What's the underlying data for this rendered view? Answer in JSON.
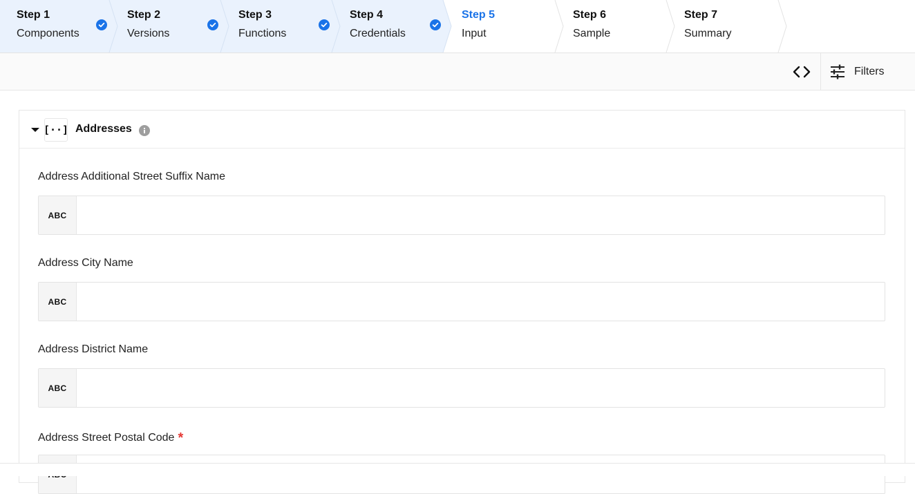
{
  "stepper": {
    "steps": [
      {
        "num": "Step 1",
        "name": "Components",
        "state": "complete"
      },
      {
        "num": "Step 2",
        "name": "Versions",
        "state": "complete"
      },
      {
        "num": "Step 3",
        "name": "Functions",
        "state": "complete"
      },
      {
        "num": "Step 4",
        "name": "Credentials",
        "state": "complete"
      },
      {
        "num": "Step 5",
        "name": "Input",
        "state": "active"
      },
      {
        "num": "Step 6",
        "name": "Sample",
        "state": "upcoming"
      },
      {
        "num": "Step 7",
        "name": "Summary",
        "state": "upcoming"
      }
    ],
    "colors": {
      "complete_bg": "#eaf2fd",
      "active_text": "#1a73e8",
      "check": "#1a73e8"
    }
  },
  "toolbar": {
    "code_icon": "code-brackets-icon",
    "filters_icon": "sliders-icon",
    "filters_label": "Filters"
  },
  "section": {
    "title": "Addresses",
    "type_icon": "array-brackets-icon",
    "type_icon_text": "[··]",
    "info_icon": "info-icon",
    "fields": [
      {
        "label": "Address Additional Street Suffix Name",
        "type": "ABC",
        "value": "",
        "required": false
      },
      {
        "label": "Address City Name",
        "type": "ABC",
        "value": "",
        "required": false
      },
      {
        "label": "Address District Name",
        "type": "ABC",
        "value": "",
        "required": false
      },
      {
        "label": "Address Street Postal Code",
        "type": "ABC",
        "value": "",
        "required": true,
        "required_mark": "*"
      }
    ]
  }
}
